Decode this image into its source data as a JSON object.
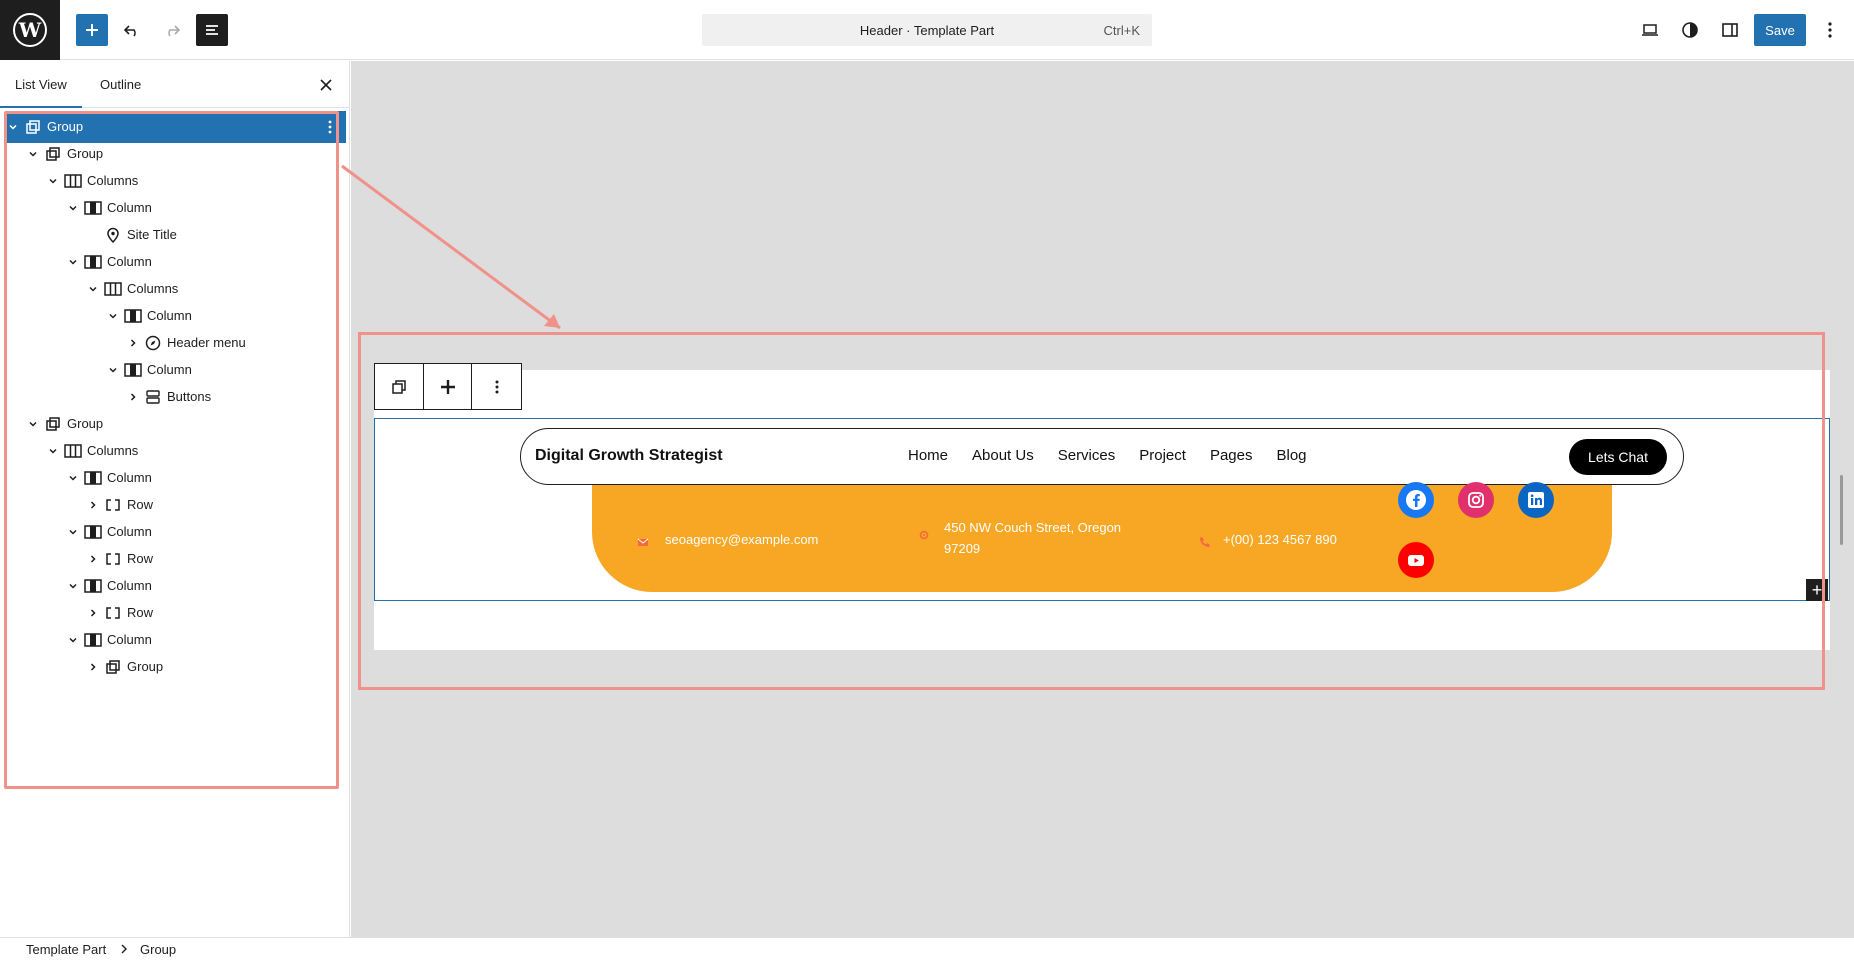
{
  "topbar": {
    "command_title": "Header · Template Part",
    "command_shortcut": "Ctrl+K",
    "save_label": "Save"
  },
  "sidebar": {
    "tabs": [
      "List View",
      "Outline"
    ],
    "tree": [
      {
        "label": "Group",
        "depth": 0,
        "expanded": true,
        "icon": "group-icon",
        "selected": true
      },
      {
        "label": "Group",
        "depth": 1,
        "expanded": true,
        "icon": "group-icon"
      },
      {
        "label": "Columns",
        "depth": 2,
        "expanded": true,
        "icon": "columns-icon"
      },
      {
        "label": "Column",
        "depth": 3,
        "expanded": true,
        "icon": "column-icon"
      },
      {
        "label": "Site Title",
        "depth": 4,
        "icon": "map-pin-icon"
      },
      {
        "label": "Column",
        "depth": 3,
        "expanded": true,
        "icon": "column-icon"
      },
      {
        "label": "Columns",
        "depth": 4,
        "expanded": true,
        "icon": "columns-icon"
      },
      {
        "label": "Column",
        "depth": 5,
        "expanded": true,
        "icon": "column-icon"
      },
      {
        "label": "Header menu",
        "depth": 6,
        "expanded": false,
        "icon": "navigation-icon"
      },
      {
        "label": "Column",
        "depth": 5,
        "expanded": true,
        "icon": "column-icon"
      },
      {
        "label": "Buttons",
        "depth": 6,
        "expanded": false,
        "icon": "buttons-icon"
      },
      {
        "label": "Group",
        "depth": 1,
        "expanded": true,
        "icon": "group-icon"
      },
      {
        "label": "Columns",
        "depth": 2,
        "expanded": true,
        "icon": "columns-icon"
      },
      {
        "label": "Column",
        "depth": 3,
        "expanded": true,
        "icon": "column-icon"
      },
      {
        "label": "Row",
        "depth": 4,
        "expanded": false,
        "icon": "row-icon"
      },
      {
        "label": "Column",
        "depth": 3,
        "expanded": true,
        "icon": "column-icon"
      },
      {
        "label": "Row",
        "depth": 4,
        "expanded": false,
        "icon": "row-icon"
      },
      {
        "label": "Column",
        "depth": 3,
        "expanded": true,
        "icon": "column-icon"
      },
      {
        "label": "Row",
        "depth": 4,
        "expanded": false,
        "icon": "row-icon"
      },
      {
        "label": "Column",
        "depth": 3,
        "expanded": true,
        "icon": "column-icon"
      },
      {
        "label": "Group",
        "depth": 4,
        "expanded": false,
        "icon": "group-icon"
      }
    ]
  },
  "canvas": {
    "site_title": "Digital Growth Strategist",
    "menu": [
      "Home",
      "About Us",
      "Services",
      "Project",
      "Pages",
      "Blog"
    ],
    "cta": "Lets Chat",
    "email": "seoagency@example.com",
    "address_line1": "450 NW Couch Street, Oregon",
    "address_line2": "97209",
    "phone": "+(00) 123 4567 890",
    "social": [
      "facebook",
      "instagram",
      "linkedin",
      "youtube"
    ]
  },
  "colors": {
    "accent": "#2271b1",
    "banner": "#f8a724",
    "highlight": "#f0918a",
    "facebook": "#1877f2",
    "instagram": "#e1306c",
    "linkedin": "#0a66c2",
    "youtube": "#ff0000"
  },
  "breadcrumb": [
    "Template Part",
    "Group"
  ]
}
